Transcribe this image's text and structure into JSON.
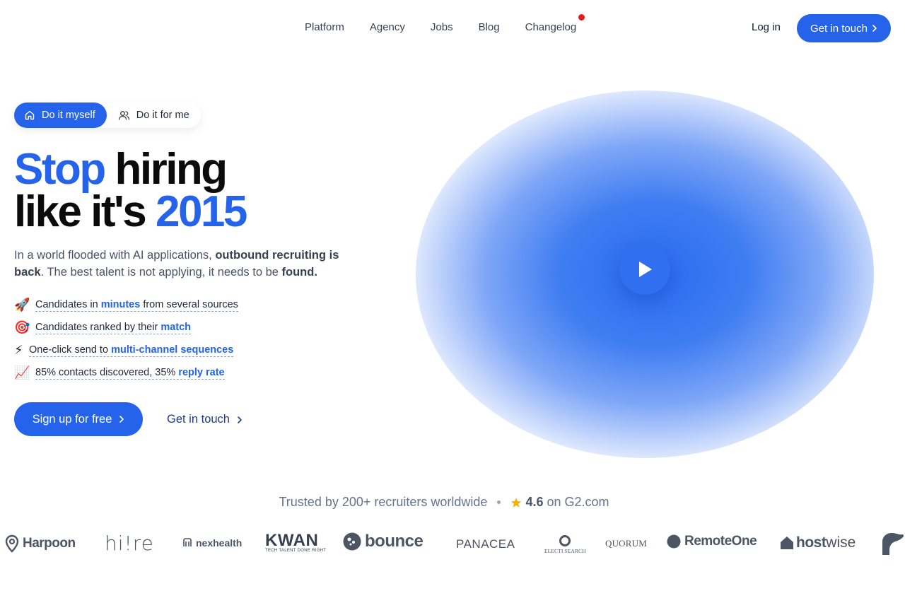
{
  "nav": {
    "links": [
      "Platform",
      "Agency",
      "Jobs",
      "Blog",
      "Changelog"
    ],
    "login": "Log in",
    "cta": "Get in touch"
  },
  "toggle": {
    "active": "Do it myself",
    "inactive": "Do it for me"
  },
  "hero": {
    "h1_word1": "Stop",
    "h1_word2": " hiring",
    "h1_word3": "like it's ",
    "h1_year": "2015",
    "lead_1": "In a world flooded with AI applications, ",
    "lead_bold1": "outbound recruiting is back",
    "lead_2": ". The best talent is not applying, it needs to be ",
    "lead_bold2": "found."
  },
  "features": [
    {
      "emoji": "🚀",
      "pre": "Candidates in ",
      "hl": "minutes",
      "post": " from several sources"
    },
    {
      "emoji": "🎯",
      "pre": "Candidates ranked by their ",
      "hl": "match",
      "post": ""
    },
    {
      "emoji": "⚡",
      "pre": "One-click send to ",
      "hl": "multi-channel sequences",
      "post": ""
    },
    {
      "emoji": "📈",
      "pre": "85% contacts discovered, 35% ",
      "hl": "reply rate",
      "post": ""
    }
  ],
  "cta": {
    "signup": "Sign up for free",
    "contact": "Get in touch"
  },
  "trust": {
    "text": "Trusted by 200+ recruiters worldwide",
    "rating": "4.6",
    "rating_suffix": "on G2.com"
  },
  "logos": {
    "harpoon": "Harpoon",
    "hiire": "hi!re",
    "nexhealth": "nexhealth",
    "kwan": "KWAN",
    "kwan_tag": "TECH TALENT DONE RIGHT",
    "bounce": "bounce",
    "panacea": "PANACEA",
    "electi": "ELECTI SEARCH",
    "quorum": "QUORUM",
    "remoteone": "RemoteOne",
    "hostwise_a": "host",
    "hostwise_b": "wise"
  },
  "colors": {
    "primary": "#2563eb",
    "notification_dot": "#e11d1d",
    "star": "#f5b301"
  },
  "icons": {
    "toggle_active": "home-icon",
    "toggle_inactive": "users-icon",
    "video": "play-icon"
  }
}
